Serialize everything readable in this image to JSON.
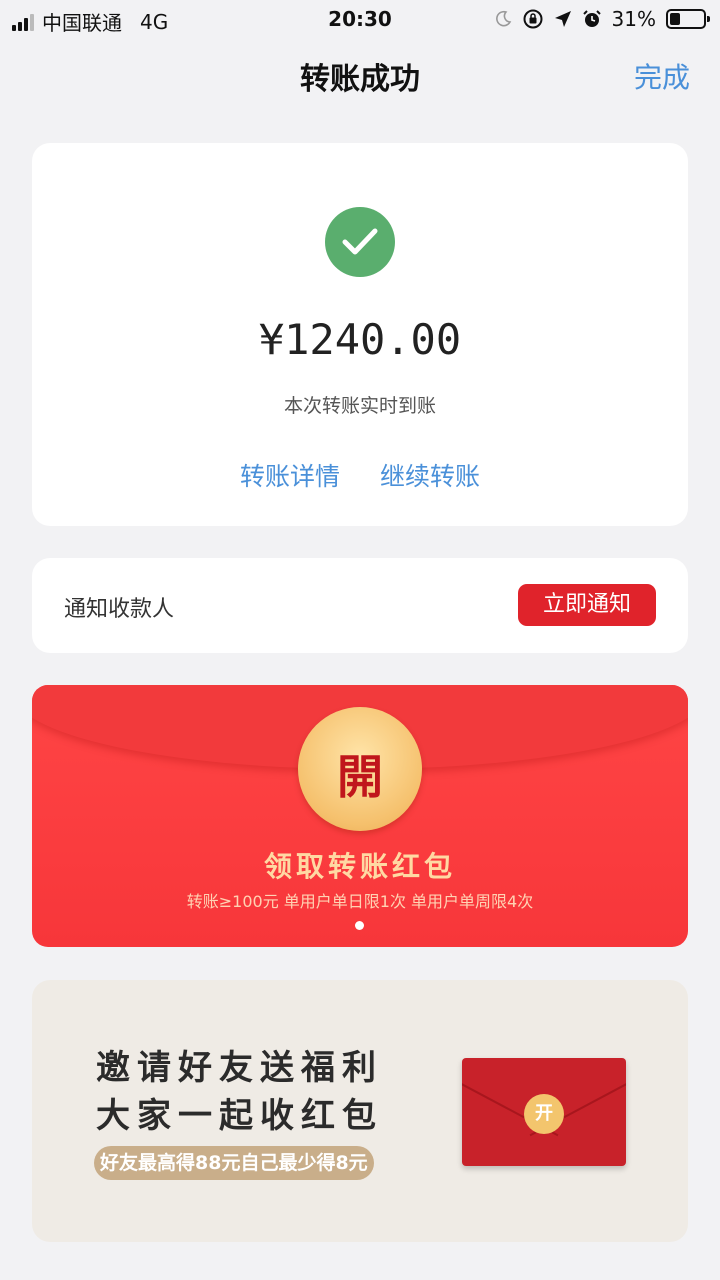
{
  "status_bar": {
    "carrier": "中国联通",
    "network": "4G",
    "time": "20:30",
    "battery": "31%",
    "battery_level": 0.31,
    "icons": [
      "signal-icon",
      "moon-icon",
      "orientation-lock-icon",
      "location-icon",
      "alarm-icon",
      "battery-icon"
    ]
  },
  "nav": {
    "title": "转账成功",
    "done": "完成"
  },
  "result": {
    "icon": "check-icon",
    "amount": "¥1240.00",
    "note": "本次转账实时到账",
    "details_link": "转账详情",
    "continue_link": "继续转账"
  },
  "notify": {
    "label": "通知收款人",
    "button": "立即通知"
  },
  "red_packet_banner": {
    "coin_text": "開",
    "title": "领取转账红包",
    "subtitle": "转账≥100元 单用户单日限1次 单用户单周限4次"
  },
  "invite_banner": {
    "line1": "邀请好友送福利",
    "line2": "大家一起收红包",
    "tag": "好友最高得88元自己最少得8元",
    "envelope_text": "开"
  },
  "colors": {
    "accent_blue": "#4a90d9",
    "success_green": "#5aae6e",
    "alert_red": "#e0232b",
    "banner_red": "#f7363a"
  }
}
